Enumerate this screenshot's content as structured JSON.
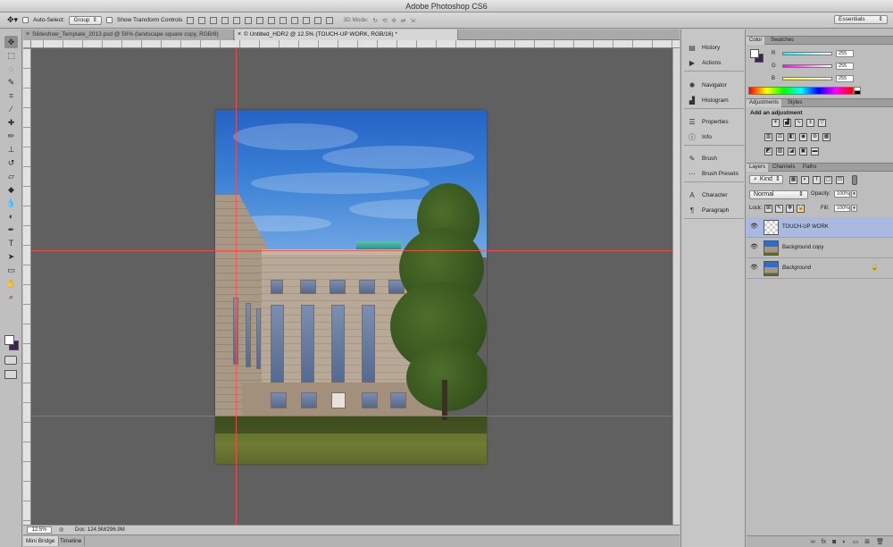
{
  "window": {
    "title": "Adobe Photoshop CS6"
  },
  "options_bar": {
    "auto_select_label": "Auto-Select:",
    "auto_select_value": "Group",
    "transform_controls_label": "Show Transform Controls",
    "mode3d_label": "3D Mode:",
    "workspace_value": "Essentials"
  },
  "documents": [
    {
      "title": "Slideshow_Template_2013.psd @ 50% (landscape square copy, RGB/8)",
      "close": "×"
    },
    {
      "title": "© Untitled_HDR2 @ 12.5% (TOUCH-UP WORK, RGB/16) *",
      "close": "×"
    }
  ],
  "status_bar": {
    "zoom": "12.5%",
    "doc_info": "Doc: 124.5M/296.9M"
  },
  "bottom_tabs": [
    "Mini Bridge",
    "Timeline"
  ],
  "collapsed_panels": [
    {
      "label": "History",
      "icon": "history-icon"
    },
    {
      "label": "Actions",
      "icon": "actions-icon"
    },
    {
      "label": "Navigator",
      "icon": "navigator-icon"
    },
    {
      "label": "Histogram",
      "icon": "histogram-icon"
    },
    {
      "label": "Properties",
      "icon": "properties-icon"
    },
    {
      "label": "Info",
      "icon": "info-icon"
    },
    {
      "label": "Brush",
      "icon": "brush-icon"
    },
    {
      "label": "Brush Presets",
      "icon": "brush-presets-icon"
    },
    {
      "label": "Character",
      "icon": "character-icon"
    },
    {
      "label": "Paragraph",
      "icon": "paragraph-icon"
    }
  ],
  "color_panel": {
    "tabs": [
      "Color",
      "Swatches"
    ],
    "channels": [
      {
        "label": "R",
        "value": "255"
      },
      {
        "label": "G",
        "value": "255"
      },
      {
        "label": "B",
        "value": "255"
      }
    ]
  },
  "adjustments_panel": {
    "tabs": [
      "Adjustments",
      "Styles"
    ],
    "heading": "Add an adjustment"
  },
  "layers_panel": {
    "tabs": [
      "Layers",
      "Channels",
      "Paths"
    ],
    "filter_label": "Kind",
    "blend_mode": "Normal",
    "opacity_label": "Opacity:",
    "opacity_value": "100%",
    "lock_label": "Lock:",
    "fill_label": "Fill:",
    "fill_value": "100%",
    "layers": [
      {
        "name": "TOUCH-UP WORK",
        "selected": true,
        "locked": false
      },
      {
        "name": "Background copy",
        "selected": false,
        "locked": false
      },
      {
        "name": "Background",
        "selected": false,
        "locked": true
      }
    ]
  },
  "colors": {
    "foreground": "#ffffff",
    "background": "#3b2356",
    "guide": "#ff4c4c",
    "selection": "#a9b9e0"
  }
}
